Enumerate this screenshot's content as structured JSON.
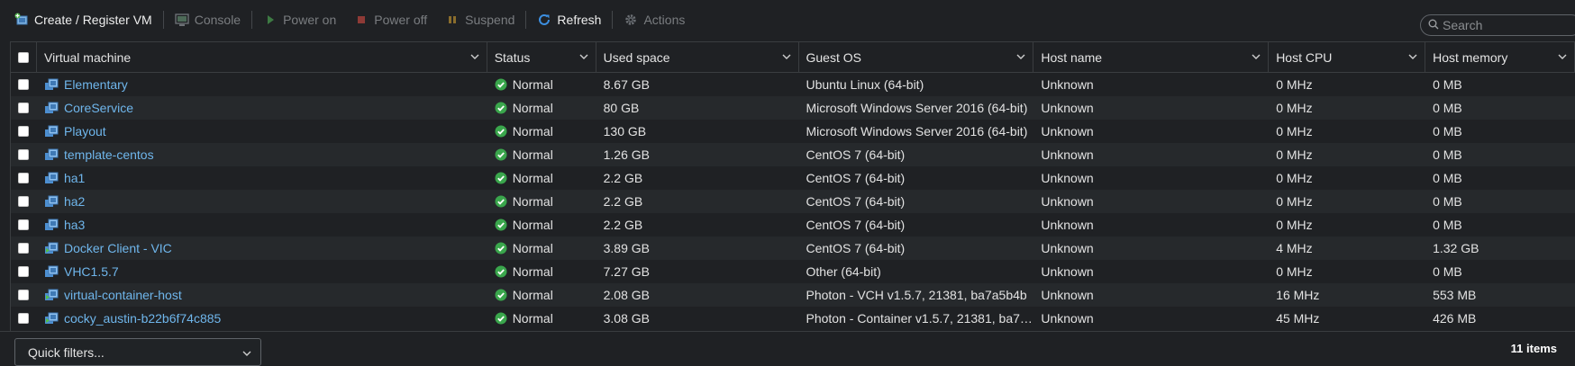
{
  "toolbar": {
    "create_register": "Create / Register VM",
    "console": "Console",
    "power_on": "Power on",
    "power_off": "Power off",
    "suspend": "Suspend",
    "refresh": "Refresh",
    "actions": "Actions"
  },
  "search": {
    "placeholder": "Search"
  },
  "columns": {
    "vm": "Virtual machine",
    "status": "Status",
    "used": "Used space",
    "os": "Guest OS",
    "host": "Host name",
    "cpu": "Host CPU",
    "mem": "Host memory"
  },
  "rows": [
    {
      "name": "Elementary",
      "icon": "vm-icon",
      "status": "Normal",
      "used": "8.67 GB",
      "os": "Ubuntu Linux (64-bit)",
      "host": "Unknown",
      "cpu": "0 MHz",
      "mem": "0 MB"
    },
    {
      "name": "CoreService",
      "icon": "vm-icon",
      "status": "Normal",
      "used": "80 GB",
      "os": "Microsoft Windows Server 2016 (64-bit)",
      "host": "Unknown",
      "cpu": "0 MHz",
      "mem": "0 MB"
    },
    {
      "name": "Playout",
      "icon": "vm-icon",
      "status": "Normal",
      "used": "130 GB",
      "os": "Microsoft Windows Server 2016 (64-bit)",
      "host": "Unknown",
      "cpu": "0 MHz",
      "mem": "0 MB"
    },
    {
      "name": "template-centos",
      "icon": "vm-icon",
      "status": "Normal",
      "used": "1.26 GB",
      "os": "CentOS 7 (64-bit)",
      "host": "Unknown",
      "cpu": "0 MHz",
      "mem": "0 MB"
    },
    {
      "name": "ha1",
      "icon": "vm-icon",
      "status": "Normal",
      "used": "2.2 GB",
      "os": "CentOS 7 (64-bit)",
      "host": "Unknown",
      "cpu": "0 MHz",
      "mem": "0 MB"
    },
    {
      "name": "ha2",
      "icon": "vm-icon",
      "status": "Normal",
      "used": "2.2 GB",
      "os": "CentOS 7 (64-bit)",
      "host": "Unknown",
      "cpu": "0 MHz",
      "mem": "0 MB"
    },
    {
      "name": "ha3",
      "icon": "vm-icon",
      "status": "Normal",
      "used": "2.2 GB",
      "os": "CentOS 7 (64-bit)",
      "host": "Unknown",
      "cpu": "0 MHz",
      "mem": "0 MB"
    },
    {
      "name": "Docker Client - VIC",
      "icon": "vm-running-icon",
      "status": "Normal",
      "used": "3.89 GB",
      "os": "CentOS 7 (64-bit)",
      "host": "Unknown",
      "cpu": "4 MHz",
      "mem": "1.32 GB"
    },
    {
      "name": "VHC1.5.7",
      "icon": "vm-icon",
      "status": "Normal",
      "used": "7.27 GB",
      "os": "Other (64-bit)",
      "host": "Unknown",
      "cpu": "0 MHz",
      "mem": "0 MB"
    },
    {
      "name": "virtual-container-host",
      "icon": "vm-running-icon",
      "status": "Normal",
      "used": "2.08 GB",
      "os": "Photon - VCH v1.5.7, 21381, ba7a5b4b",
      "host": "Unknown",
      "cpu": "16 MHz",
      "mem": "553 MB"
    },
    {
      "name": "cocky_austin-b22b6f74c885",
      "icon": "vm-running-icon",
      "status": "Normal",
      "used": "3.08 GB",
      "os": "Photon - Container v1.5.7, 21381, ba7a…",
      "host": "Unknown",
      "cpu": "45 MHz",
      "mem": "426 MB"
    }
  ],
  "footer": {
    "quick_filters": "Quick filters...",
    "count": "11 items"
  },
  "colors": {
    "background": "#1f2124",
    "link": "#6fb6ec",
    "status_ok": "#3aa64c",
    "stripe": "#26292c"
  }
}
